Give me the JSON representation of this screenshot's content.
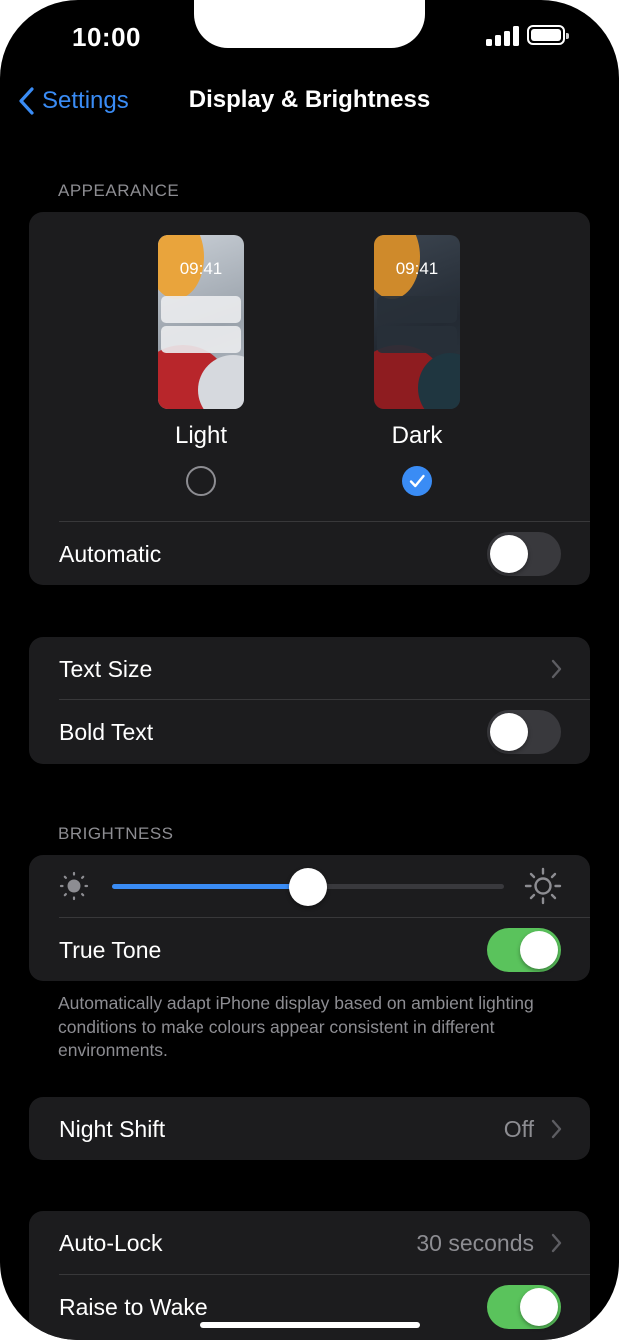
{
  "status_bar": {
    "time": "10:00"
  },
  "nav": {
    "back_label": "Settings",
    "title": "Display & Brightness"
  },
  "appearance": {
    "header": "APPEARANCE",
    "options": [
      {
        "label": "Light",
        "preview_time": "09:41",
        "selected": false
      },
      {
        "label": "Dark",
        "preview_time": "09:41",
        "selected": true
      }
    ],
    "automatic": {
      "label": "Automatic",
      "on": false
    }
  },
  "text": {
    "text_size_label": "Text Size",
    "bold_text": {
      "label": "Bold Text",
      "on": false
    }
  },
  "brightness": {
    "header": "BRIGHTNESS",
    "level": 0.5,
    "true_tone": {
      "label": "True Tone",
      "on": true
    },
    "footnote": "Automatically adapt iPhone display based on ambient lighting conditions to make colours appear consistent in different environments."
  },
  "night_shift": {
    "label": "Night Shift",
    "value": "Off"
  },
  "lock": {
    "auto_lock": {
      "label": "Auto-Lock",
      "value": "30 seconds"
    },
    "raise_to_wake": {
      "label": "Raise to Wake",
      "on": true
    }
  },
  "colors": {
    "accent": "#3a8cf5",
    "toggle_on": "#5ac35c",
    "toggle_off": "#39393d",
    "group_bg": "#1c1c1e"
  },
  "icons": [
    "back-chevron-icon",
    "signal-icon",
    "battery-icon",
    "checkmark-icon",
    "chevron-right-icon",
    "sun-small-icon",
    "sun-large-icon"
  ]
}
